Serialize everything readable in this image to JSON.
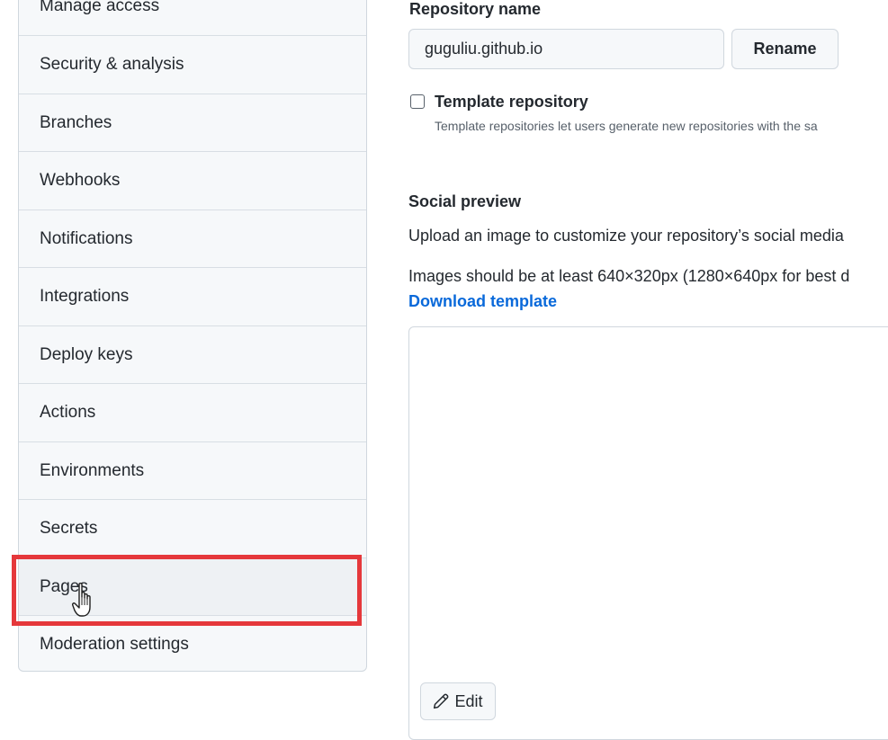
{
  "sidebar": {
    "items": [
      {
        "label": "Manage access"
      },
      {
        "label": "Security & analysis"
      },
      {
        "label": "Branches"
      },
      {
        "label": "Webhooks"
      },
      {
        "label": "Notifications"
      },
      {
        "label": "Integrations"
      },
      {
        "label": "Deploy keys"
      },
      {
        "label": "Actions"
      },
      {
        "label": "Environments"
      },
      {
        "label": "Secrets"
      },
      {
        "label": "Pages"
      },
      {
        "label": "Moderation settings"
      }
    ]
  },
  "repository": {
    "name_label": "Repository name",
    "name_value": "guguliu.github.io",
    "rename_label": "Rename",
    "template_label": "Template repository",
    "template_note": "Template repositories let users generate new repositories with the sa"
  },
  "social_preview": {
    "title": "Social preview",
    "description": "Upload an image to customize your repository’s social media",
    "size_note": "Images should be at least 640×320px (1280×640px for best d",
    "download_link": "Download template",
    "edit_label": "Edit"
  },
  "colors": {
    "highlight": "#e5383b",
    "link": "#0969da"
  }
}
